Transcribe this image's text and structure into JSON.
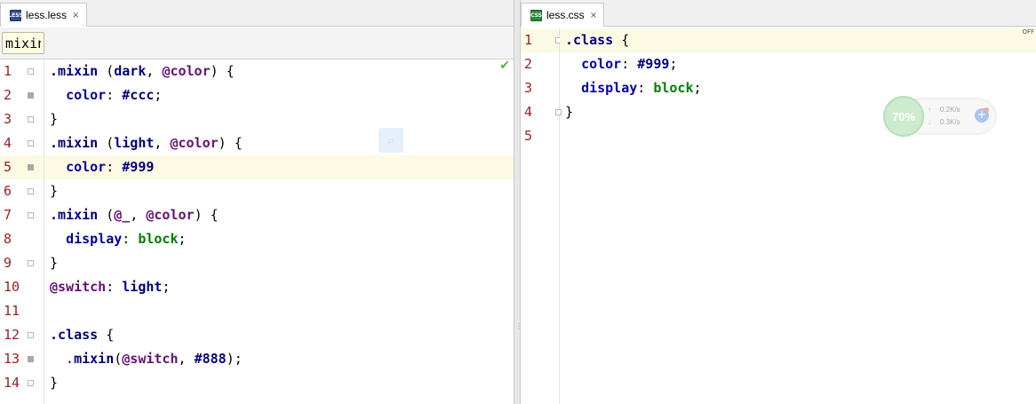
{
  "left": {
    "tab": {
      "icon_text": "LESS",
      "icon": "less-file-icon",
      "label": "less.less",
      "close": "×"
    },
    "search": {
      "value": "mixin"
    },
    "lines": [
      {
        "num": "1",
        "fold": true,
        "bookmark": false,
        "current": false,
        "tokens": [
          [
            "sel",
            ".mixin"
          ],
          [
            "plain",
            " ("
          ],
          [
            "sel",
            "dark"
          ],
          [
            "plain",
            ", "
          ],
          [
            "var",
            "@color"
          ],
          [
            "plain",
            ") {"
          ]
        ]
      },
      {
        "num": "2",
        "fold": false,
        "bookmark": true,
        "current": false,
        "tokens": [
          [
            "plain",
            "  "
          ],
          [
            "prop",
            "color"
          ],
          [
            "plain",
            ": "
          ],
          [
            "num",
            "#ccc"
          ],
          [
            "plain",
            ";"
          ]
        ]
      },
      {
        "num": "3",
        "fold": true,
        "bookmark": false,
        "current": false,
        "tokens": [
          [
            "plain",
            "}"
          ]
        ]
      },
      {
        "num": "4",
        "fold": true,
        "bookmark": false,
        "current": false,
        "tokens": [
          [
            "sel",
            ".mixin"
          ],
          [
            "plain",
            " ("
          ],
          [
            "sel",
            "light"
          ],
          [
            "plain",
            ", "
          ],
          [
            "var",
            "@color"
          ],
          [
            "plain",
            ") {"
          ]
        ]
      },
      {
        "num": "5",
        "fold": false,
        "bookmark": true,
        "current": true,
        "tokens": [
          [
            "plain",
            "  "
          ],
          [
            "prop",
            "color"
          ],
          [
            "plain",
            ": "
          ],
          [
            "num",
            "#999"
          ]
        ]
      },
      {
        "num": "6",
        "fold": true,
        "bookmark": false,
        "current": false,
        "tokens": [
          [
            "plain",
            "}"
          ]
        ]
      },
      {
        "num": "7",
        "fold": true,
        "bookmark": false,
        "current": false,
        "tokens": [
          [
            "sel",
            ".mixin"
          ],
          [
            "plain",
            " ("
          ],
          [
            "var",
            "@_"
          ],
          [
            "plain",
            ", "
          ],
          [
            "var",
            "@color"
          ],
          [
            "plain",
            ") {"
          ]
        ]
      },
      {
        "num": "8",
        "fold": false,
        "bookmark": false,
        "current": false,
        "tokens": [
          [
            "plain",
            "  "
          ],
          [
            "prop",
            "display"
          ],
          [
            "plain",
            ": "
          ],
          [
            "kw",
            "block"
          ],
          [
            "plain",
            ";"
          ]
        ]
      },
      {
        "num": "9",
        "fold": true,
        "bookmark": false,
        "current": false,
        "tokens": [
          [
            "plain",
            "}"
          ]
        ]
      },
      {
        "num": "10",
        "fold": false,
        "bookmark": false,
        "current": false,
        "tokens": [
          [
            "var",
            "@switch"
          ],
          [
            "plain",
            ": "
          ],
          [
            "sel",
            "light"
          ],
          [
            "plain",
            ";"
          ]
        ]
      },
      {
        "num": "11",
        "fold": false,
        "bookmark": false,
        "current": false,
        "tokens": []
      },
      {
        "num": "12",
        "fold": true,
        "bookmark": false,
        "current": false,
        "tokens": [
          [
            "sel",
            ".class"
          ],
          [
            "plain",
            " {"
          ]
        ]
      },
      {
        "num": "13",
        "fold": false,
        "bookmark": true,
        "current": false,
        "tokens": [
          [
            "plain",
            "  ."
          ],
          [
            "sel",
            "mixin"
          ],
          [
            "plain",
            "("
          ],
          [
            "var",
            "@switch"
          ],
          [
            "plain",
            ", "
          ],
          [
            "num",
            "#888"
          ],
          [
            "plain",
            ");"
          ]
        ]
      },
      {
        "num": "14",
        "fold": true,
        "bookmark": false,
        "current": false,
        "tokens": [
          [
            "plain",
            "}"
          ]
        ]
      }
    ]
  },
  "right": {
    "tab": {
      "icon_text": "CSS",
      "icon": "css-file-icon",
      "label": "less.css",
      "close": "×"
    },
    "off_label": "OFF",
    "lines": [
      {
        "num": "1",
        "fold": true,
        "current": true,
        "tokens": [
          [
            "sel",
            ".class"
          ],
          [
            "plain",
            " {"
          ]
        ]
      },
      {
        "num": "2",
        "fold": false,
        "current": false,
        "tokens": [
          [
            "plain",
            "  "
          ],
          [
            "prop",
            "color"
          ],
          [
            "plain",
            ": "
          ],
          [
            "num",
            "#999"
          ],
          [
            "plain",
            ";"
          ]
        ]
      },
      {
        "num": "3",
        "fold": false,
        "current": false,
        "tokens": [
          [
            "plain",
            "  "
          ],
          [
            "prop",
            "display"
          ],
          [
            "plain",
            ": "
          ],
          [
            "kw",
            "block"
          ],
          [
            "plain",
            ";"
          ]
        ]
      },
      {
        "num": "4",
        "fold": true,
        "current": false,
        "tokens": [
          [
            "plain",
            "}"
          ]
        ]
      },
      {
        "num": "5",
        "fold": false,
        "current": false,
        "tokens": []
      }
    ]
  },
  "widget": {
    "percent": "70%",
    "upload": "0.2K/s",
    "download": "0.3K/s",
    "up_arrow": "↑",
    "down_arrow": "↓",
    "plus": "+"
  },
  "status": {
    "check": "✔"
  },
  "colors": {
    "line_number": "#992222",
    "selector": "#000080",
    "property": "#0000a0",
    "variable": "#660e7a",
    "keyword": "#008000",
    "current_line": "#fdfae4"
  }
}
